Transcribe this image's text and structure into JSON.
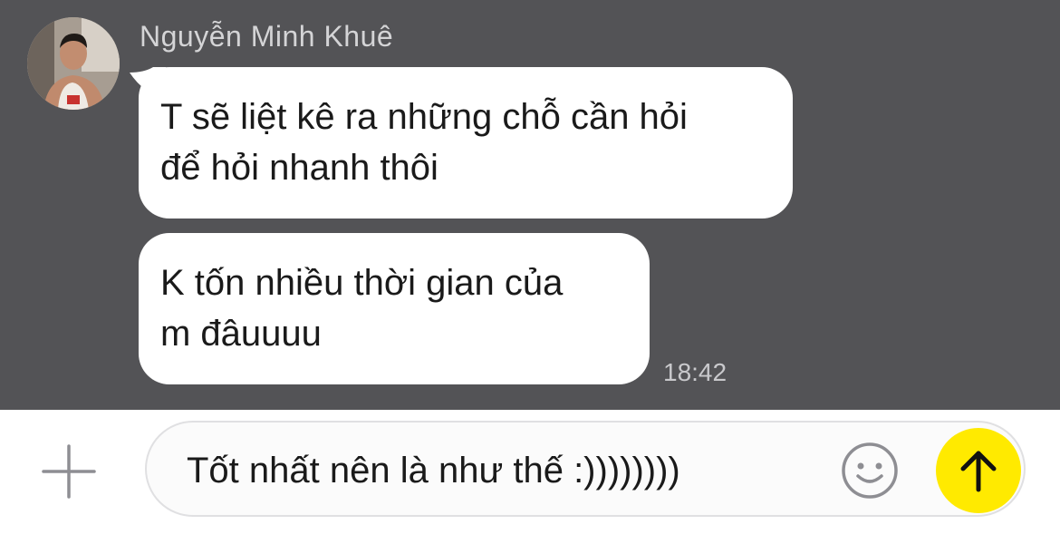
{
  "chat": {
    "sender_name": "Nguyễn Minh Khuê",
    "messages": [
      {
        "lines": [
          "T sẽ liệt kê ra những chỗ cần hỏi",
          "để hỏi nhanh thôi"
        ]
      },
      {
        "lines": [
          "K tốn nhiều thời gian của",
          "m đâuuuu"
        ],
        "time": "18:42"
      }
    ]
  },
  "composer": {
    "input_value": "Tốt nhất nên là như thế :))))))))",
    "plus_icon": "plus-icon",
    "emoji_icon": "smiley-icon",
    "send_icon": "arrow-up-icon"
  },
  "colors": {
    "chat_background": "#535356",
    "bubble": "#ffffff",
    "send_button": "#ffea00"
  }
}
